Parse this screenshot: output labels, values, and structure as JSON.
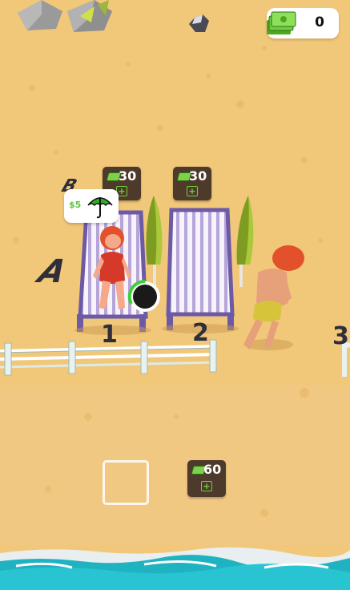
{
  "hud": {
    "cash_value": "0",
    "cash_icon": "money-stack-icon",
    "accent": "#5fc241"
  },
  "lanes": [
    {
      "letter": "B"
    },
    {
      "letter": "A"
    }
  ],
  "slots": [
    {
      "number": "1",
      "price": "30"
    },
    {
      "number": "2",
      "price": "30"
    },
    {
      "number": "3"
    }
  ],
  "customer_request": {
    "price": "$5",
    "icon": "umbrella-icon"
  },
  "expansion": {
    "price": "60",
    "unlock_icon": "plus-icon"
  },
  "colors": {
    "sand": "#f1c779",
    "sea": "#1fb3c2",
    "lounger_stripe": "#a08bc8",
    "umbrella": "#a9c93a",
    "money": "#6fcf3d"
  }
}
